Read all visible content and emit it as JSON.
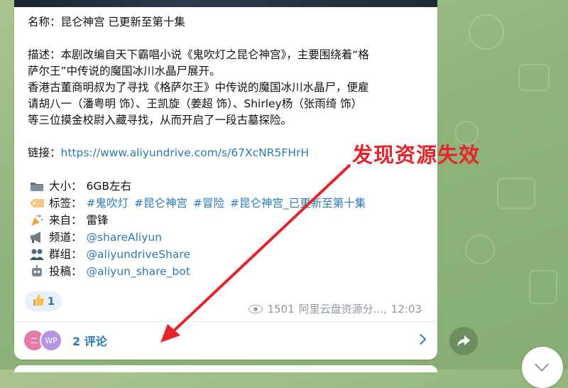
{
  "post": {
    "name_line": "名称：昆仑神宫 已更新至第十集",
    "desc_lines": [
      "描述：本剧改编自天下霸唱小说《鬼吹灯之昆仑神宫》，主要围绕着“格",
      "萨尔王”中传说的魔国冰川水晶尸展开。",
      "香港古董商明叔为了寻找《格萨尔王》中传说的魔国冰川水晶尸，便雇",
      "请胡八一（潘粤明 饰）、王凯旋（姜超 饰）、Shirley杨（张雨绮 饰）",
      "等三位摸金校尉入藏寻找，从而开启了一段古墓探险。"
    ],
    "link_label": "链接：",
    "link_url": "https://www.aliyundrive.com/s/67XcNR5FHrH",
    "size": {
      "icon": "folder-icon",
      "label": "大小",
      "value": "6GB左右"
    },
    "tags": {
      "icon": "tag-icon",
      "label": "标签",
      "values": [
        "#鬼吹灯",
        "#昆仑神宫",
        "#冒险",
        "#昆仑神宫_已更新至第十集"
      ]
    },
    "source": {
      "icon": "party-popper-icon",
      "label": "来自",
      "value": "雷锋"
    },
    "channel": {
      "icon": "megaphone-icon",
      "label": "频道",
      "value": "@shareAliyun"
    },
    "group": {
      "icon": "people-icon",
      "label": "群组",
      "value": "@aliyundriveShare"
    },
    "submit": {
      "icon": "robot-icon",
      "label": "投稿",
      "value": "@aliyun_share_bot"
    }
  },
  "reaction": {
    "icon": "thumbs-up-icon",
    "count": "1"
  },
  "meta": {
    "views": "1501",
    "author": "阿里云盘资源分...",
    "time": "12:03"
  },
  "comments": {
    "avatar1": "二",
    "avatar2": "WP",
    "label": "2 评论"
  },
  "annotation": {
    "text": "发现资源失效",
    "color": "#e8242a"
  },
  "colors": {
    "link": "#2a7ab8",
    "background": "#98ba80"
  }
}
